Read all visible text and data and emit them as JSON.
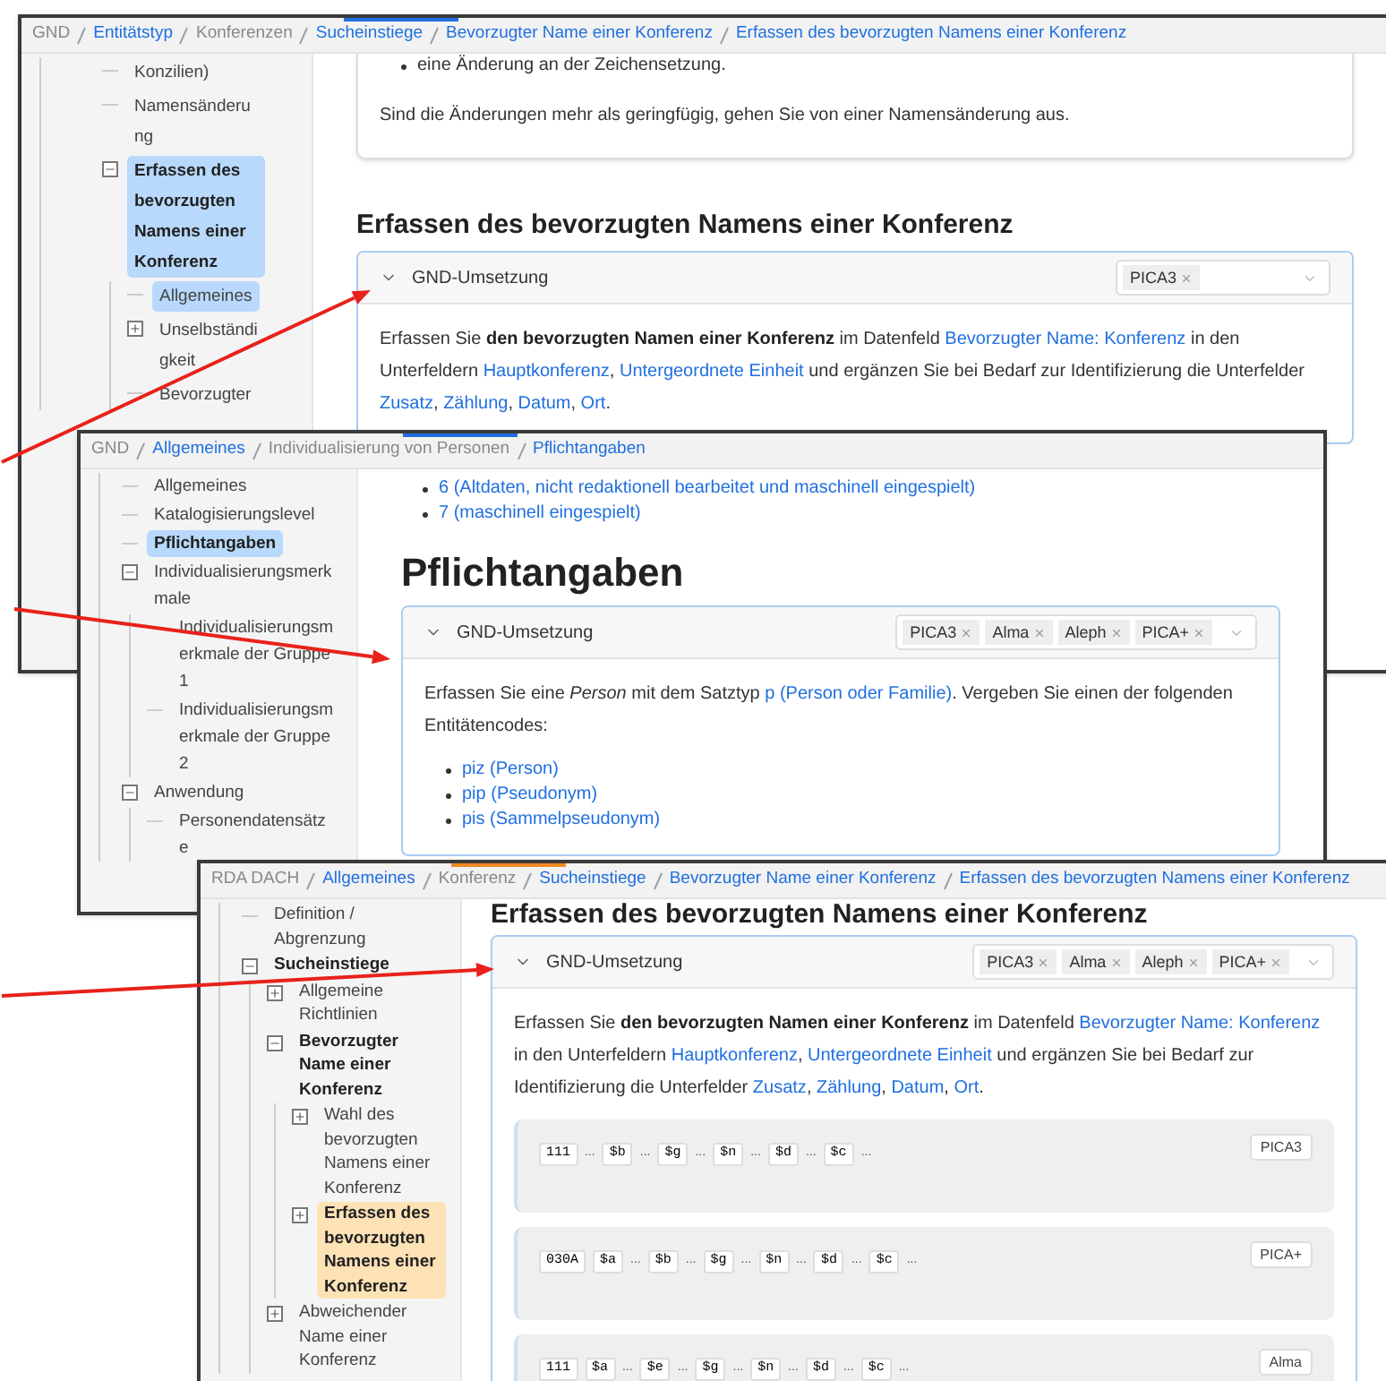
{
  "windows": [
    {
      "kind": "gnd",
      "breadcrumb": [
        {
          "text": "GND",
          "link": false
        },
        {
          "text": "Entitätstyp",
          "link": true
        },
        {
          "text": "Konferenzen",
          "link": false
        },
        {
          "text": "Sucheinstiege",
          "link": true
        },
        {
          "text": "Bevorzugter Name einer Konferenz",
          "link": true
        },
        {
          "text": "Erfassen des bevorzugten Namens einer Konferenz",
          "link": true
        }
      ],
      "sidebar": {
        "items": [
          {
            "label": "Konzilien)",
            "bold": false,
            "selected": false
          },
          {
            "label": "Namensänderung",
            "bold": false,
            "selected": false
          },
          {
            "label": "Erfassen des bevorzugten Namens einer Konferenz",
            "bold": true,
            "selected": true,
            "expanded": true,
            "children": [
              {
                "label": "Allgemeines",
                "bold": false,
                "selected": true
              },
              {
                "label": "Unselbständigkeit",
                "bold": false,
                "selected": false,
                "expanded": false
              },
              {
                "label": "Bevorzugter",
                "bold": false,
                "selected": false
              }
            ]
          }
        ]
      },
      "content": [
        {
          "kind": "card",
          "blocks": [
            {
              "kind": "bullets",
              "items": [
                [
                  {
                    "kind": "plain",
                    "text": "eine Änderung an der Zeichensetzung."
                  }
                ]
              ]
            },
            {
              "kind": "paragraph",
              "segments": [
                {
                  "kind": "plain",
                  "text": "Sind die Änderungen mehr als geringfügig, gehen Sie von einer Namensänderung aus."
                }
              ]
            }
          ]
        },
        {
          "kind": "heading",
          "text": "Erfassen des bevorzugten Namens einer Konferenz"
        },
        {
          "kind": "accordion",
          "title": "GND-Umsetzung",
          "expanded": true,
          "tags": [
            "PICA3"
          ],
          "blocks": [
            {
              "kind": "paragraph",
              "segments": [
                {
                  "kind": "plain",
                  "text": "Erfassen Sie "
                },
                {
                  "kind": "bold",
                  "text": "den bevorzugten Namen einer Konferenz"
                },
                {
                  "kind": "plain",
                  "text": " im Datenfeld "
                },
                {
                  "kind": "link",
                  "text": "Bevorzugter Name: Konferenz"
                },
                {
                  "kind": "plain",
                  "text": " in den Unterfeldern "
                },
                {
                  "kind": "link",
                  "text": "Hauptkonferenz"
                },
                {
                  "kind": "plain",
                  "text": ", "
                },
                {
                  "kind": "link",
                  "text": "Untergeordnete Einheit"
                },
                {
                  "kind": "plain",
                  "text": " und ergänzen Sie bei Bedarf zur Identifizierung die Unterfelder "
                },
                {
                  "kind": "link",
                  "text": "Zusatz"
                },
                {
                  "kind": "plain",
                  "text": ", "
                },
                {
                  "kind": "link",
                  "text": "Zählung"
                },
                {
                  "kind": "plain",
                  "text": ", "
                },
                {
                  "kind": "link",
                  "text": "Datum"
                },
                {
                  "kind": "plain",
                  "text": ", "
                },
                {
                  "kind": "link",
                  "text": "Ort"
                },
                {
                  "kind": "plain",
                  "text": "."
                }
              ]
            }
          ]
        }
      ]
    },
    {
      "kind": "gnd",
      "breadcrumb": [
        {
          "text": "GND",
          "link": false
        },
        {
          "text": "Allgemeines",
          "link": true
        },
        {
          "text": "Individualisierung von Personen",
          "link": false
        },
        {
          "text": "Pflichtangaben",
          "link": true
        }
      ],
      "sidebar": {
        "items": [
          {
            "label": "Allgemeines",
            "bold": false,
            "selected": false
          },
          {
            "label": "Katalogisierungslevel",
            "bold": false,
            "selected": false
          },
          {
            "label": "Pflichtangaben",
            "bold": true,
            "selected": true
          },
          {
            "label": "Individualisierungsmerkmale",
            "bold": false,
            "selected": false,
            "expanded": true,
            "children": [
              {
                "label": "Individualisierungsmerkmale der Gruppe 1",
                "bold": false,
                "selected": false
              },
              {
                "label": "Individualisierungsmerkmale der Gruppe 2",
                "bold": false,
                "selected": false
              }
            ]
          },
          {
            "label": "Anwendung",
            "bold": false,
            "selected": false,
            "expanded": true,
            "children": [
              {
                "label": "Personendatensätze",
                "bold": false,
                "selected": false
              }
            ]
          }
        ]
      },
      "content": [
        {
          "kind": "bullets",
          "items": [
            [
              {
                "kind": "link",
                "text": "6 (Altdaten, nicht redaktionell bearbeitet und maschinell eingespielt)"
              }
            ],
            [
              {
                "kind": "link",
                "text": "7 (maschinell eingespielt)"
              }
            ]
          ]
        },
        {
          "kind": "title",
          "text": "Pflichtangaben"
        },
        {
          "kind": "accordion",
          "title": "GND-Umsetzung",
          "expanded": true,
          "tags": [
            "PICA3",
            "Alma",
            "Aleph",
            "PICA+"
          ],
          "blocks": [
            {
              "kind": "paragraph",
              "segments": [
                {
                  "kind": "plain",
                  "text": "Erfassen Sie eine "
                },
                {
                  "kind": "italic",
                  "text": "Person"
                },
                {
                  "kind": "plain",
                  "text": " mit dem Satztyp "
                },
                {
                  "kind": "link",
                  "text": "p (Person oder Familie)"
                },
                {
                  "kind": "plain",
                  "text": ". Vergeben Sie einen der folgenden Entitätencodes:"
                }
              ]
            },
            {
              "kind": "bullets",
              "items": [
                [
                  {
                    "kind": "link",
                    "text": "piz (Person)"
                  }
                ],
                [
                  {
                    "kind": "link",
                    "text": "pip (Pseudonym)"
                  }
                ],
                [
                  {
                    "kind": "link",
                    "text": "pis (Sammelpseudonym)"
                  }
                ]
              ]
            }
          ]
        }
      ]
    },
    {
      "kind": "rda",
      "breadcrumb": [
        {
          "text": "RDA DACH",
          "link": false
        },
        {
          "text": "Allgemeines",
          "link": true
        },
        {
          "text": "Konferenz",
          "link": false
        },
        {
          "text": "Sucheinstiege",
          "link": true
        },
        {
          "text": "Bevorzugter Name einer Konferenz",
          "link": true
        },
        {
          "text": "Erfassen des bevorzugten Namens einer Konferenz",
          "link": true
        }
      ],
      "sidebar": {
        "items": [
          {
            "label": "Definition / Abgrenzung",
            "bold": false,
            "selected": false
          },
          {
            "label": "Sucheinstiege",
            "bold": true,
            "selected": false,
            "expanded": true,
            "children": [
              {
                "label": "Allgemeine Richtlinien",
                "bold": false,
                "selected": false,
                "expanded": false
              },
              {
                "label": "Bevorzugter Name einer Konferenz",
                "bold": true,
                "selected": false,
                "expanded": true,
                "children": [
                  {
                    "label": "Wahl des bevorzugten Namens einer Konferenz",
                    "bold": false,
                    "selected": false,
                    "expanded": false
                  },
                  {
                    "label": "Erfassen des bevorzugten Namens einer Konferenz",
                    "bold": true,
                    "selected": true,
                    "expanded": false
                  }
                ]
              },
              {
                "label": "Abweichender Name einer Konferenz",
                "bold": false,
                "selected": false,
                "expanded": false
              }
            ]
          }
        ]
      },
      "content": [
        {
          "kind": "heading",
          "text": "Erfassen des bevorzugten Namens einer Konferenz"
        },
        {
          "kind": "accordion",
          "title": "GND-Umsetzung",
          "expanded": true,
          "tags": [
            "PICA3",
            "Alma",
            "Aleph",
            "PICA+"
          ],
          "blocks": [
            {
              "kind": "paragraph",
              "segments": [
                {
                  "kind": "plain",
                  "text": "Erfassen Sie "
                },
                {
                  "kind": "bold",
                  "text": "den bevorzugten Namen einer Konferenz"
                },
                {
                  "kind": "plain",
                  "text": " im Datenfeld "
                },
                {
                  "kind": "link",
                  "text": "Bevorzugter Name: Konferenz"
                },
                {
                  "kind": "plain",
                  "text": " in den Unterfeldern "
                },
                {
                  "kind": "link",
                  "text": "Hauptkonferenz"
                },
                {
                  "kind": "plain",
                  "text": ", "
                },
                {
                  "kind": "link",
                  "text": "Untergeordnete Einheit"
                },
                {
                  "kind": "plain",
                  "text": " und ergänzen Sie bei Bedarf zur Identifizierung die Unterfelder "
                },
                {
                  "kind": "link",
                  "text": "Zusatz"
                },
                {
                  "kind": "plain",
                  "text": ", "
                },
                {
                  "kind": "link",
                  "text": "Zählung"
                },
                {
                  "kind": "plain",
                  "text": ", "
                },
                {
                  "kind": "link",
                  "text": "Datum"
                },
                {
                  "kind": "plain",
                  "text": ", "
                },
                {
                  "kind": "link",
                  "text": "Ort"
                },
                {
                  "kind": "plain",
                  "text": "."
                }
              ]
            },
            {
              "kind": "code",
              "format": "PICA3",
              "tokens": [
                {
                  "kind": "code",
                  "text": "111"
                },
                {
                  "kind": "plain",
                  "text": "..."
                },
                {
                  "kind": "code",
                  "text": "$b"
                },
                {
                  "kind": "plain",
                  "text": "..."
                },
                {
                  "kind": "code",
                  "text": "$g"
                },
                {
                  "kind": "plain",
                  "text": "..."
                },
                {
                  "kind": "code",
                  "text": "$n"
                },
                {
                  "kind": "plain",
                  "text": "..."
                },
                {
                  "kind": "code",
                  "text": "$d"
                },
                {
                  "kind": "plain",
                  "text": "..."
                },
                {
                  "kind": "code",
                  "text": "$c"
                },
                {
                  "kind": "plain",
                  "text": "..."
                }
              ]
            },
            {
              "kind": "code",
              "format": "PICA+",
              "tokens": [
                {
                  "kind": "code",
                  "text": "030A"
                },
                {
                  "kind": "code",
                  "text": "$a"
                },
                {
                  "kind": "plain",
                  "text": "..."
                },
                {
                  "kind": "code",
                  "text": "$b"
                },
                {
                  "kind": "plain",
                  "text": "..."
                },
                {
                  "kind": "code",
                  "text": "$g"
                },
                {
                  "kind": "plain",
                  "text": "..."
                },
                {
                  "kind": "code",
                  "text": "$n"
                },
                {
                  "kind": "plain",
                  "text": "..."
                },
                {
                  "kind": "code",
                  "text": "$d"
                },
                {
                  "kind": "plain",
                  "text": "..."
                },
                {
                  "kind": "code",
                  "text": "$c"
                },
                {
                  "kind": "plain",
                  "text": "..."
                }
              ]
            },
            {
              "kind": "code",
              "format": "Alma",
              "tokens": [
                {
                  "kind": "code",
                  "text": "111"
                },
                {
                  "kind": "code",
                  "text": "$a"
                },
                {
                  "kind": "plain",
                  "text": "..."
                },
                {
                  "kind": "code",
                  "text": "$e"
                },
                {
                  "kind": "plain",
                  "text": "..."
                },
                {
                  "kind": "code",
                  "text": "$g"
                },
                {
                  "kind": "plain",
                  "text": "..."
                },
                {
                  "kind": "code",
                  "text": "$n"
                },
                {
                  "kind": "plain",
                  "text": "..."
                },
                {
                  "kind": "code",
                  "text": "$d"
                },
                {
                  "kind": "plain",
                  "text": "..."
                },
                {
                  "kind": "code",
                  "text": "$c"
                },
                {
                  "kind": "plain",
                  "text": "..."
                }
              ]
            }
          ]
        }
      ]
    }
  ]
}
